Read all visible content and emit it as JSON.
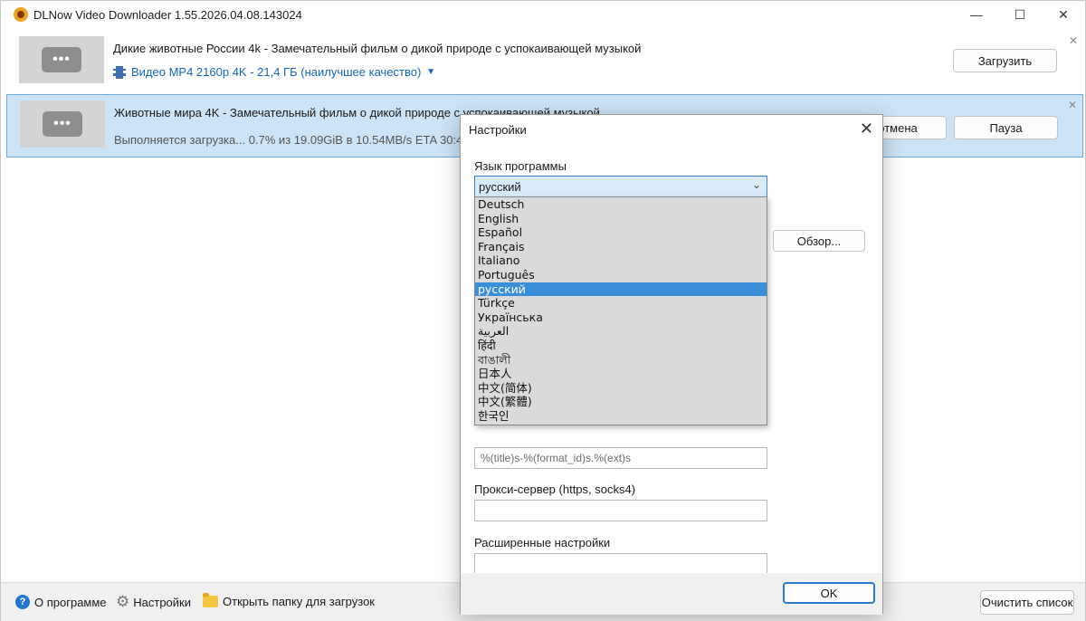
{
  "window": {
    "title": "DLNow Video Downloader 1.55.2026.04.08.143024",
    "controls": {
      "minimize": "—",
      "maximize": "☐",
      "close": "✕"
    }
  },
  "downloads": [
    {
      "title": "Дикие животные России 4k - Замечательный фильм о дикой природе с успокаивающей музыкой",
      "format": "Видео MP4 2160p 4K - 21,4 ГБ (наилучшее качество)",
      "button": "Загрузить",
      "close": "✕"
    },
    {
      "title": "Животные мира 4K - Замечательный фильм о дикой природе с успокаивающей музыкой",
      "status": "Выполняется загрузка...  0.7% из   19.09GiB в   10.54MB/s ETA 30:41",
      "cancel_button": "отмена",
      "pause_button": "Пауза",
      "close": "✕"
    }
  ],
  "thumbnail_glyph": "•••",
  "bottombar": {
    "about": "О программе",
    "settings": "Настройки",
    "open_folder": "Открыть папку для загрузок",
    "clear": "Очистить список"
  },
  "dialog": {
    "title": "Настройки",
    "close": "✕",
    "language_label": "Язык программы",
    "language_selected": "русский",
    "browse_button": "Обзор...",
    "filename_template": "%(title)s-%(format_id)s.%(ext)s",
    "proxy_label": "Прокси-сервер (https, socks4)",
    "proxy_value": "",
    "advanced_label": "Расширенные настройки",
    "advanced_value": "",
    "ok_button": "OK"
  },
  "language_options": [
    "Deutsch",
    "English",
    "Español",
    "Français",
    "Italiano",
    "Português",
    "русский",
    "Türkçe",
    "Українська",
    "العربية",
    "हिंदी",
    "বাঙালী",
    "日本人",
    "中文(简体)",
    "中文(繁體)",
    "한국인"
  ],
  "language_selected_index": 6,
  "colors": {
    "accent": "#3b8fd8",
    "active_row": "#cce4f7",
    "link": "#1565c0"
  }
}
